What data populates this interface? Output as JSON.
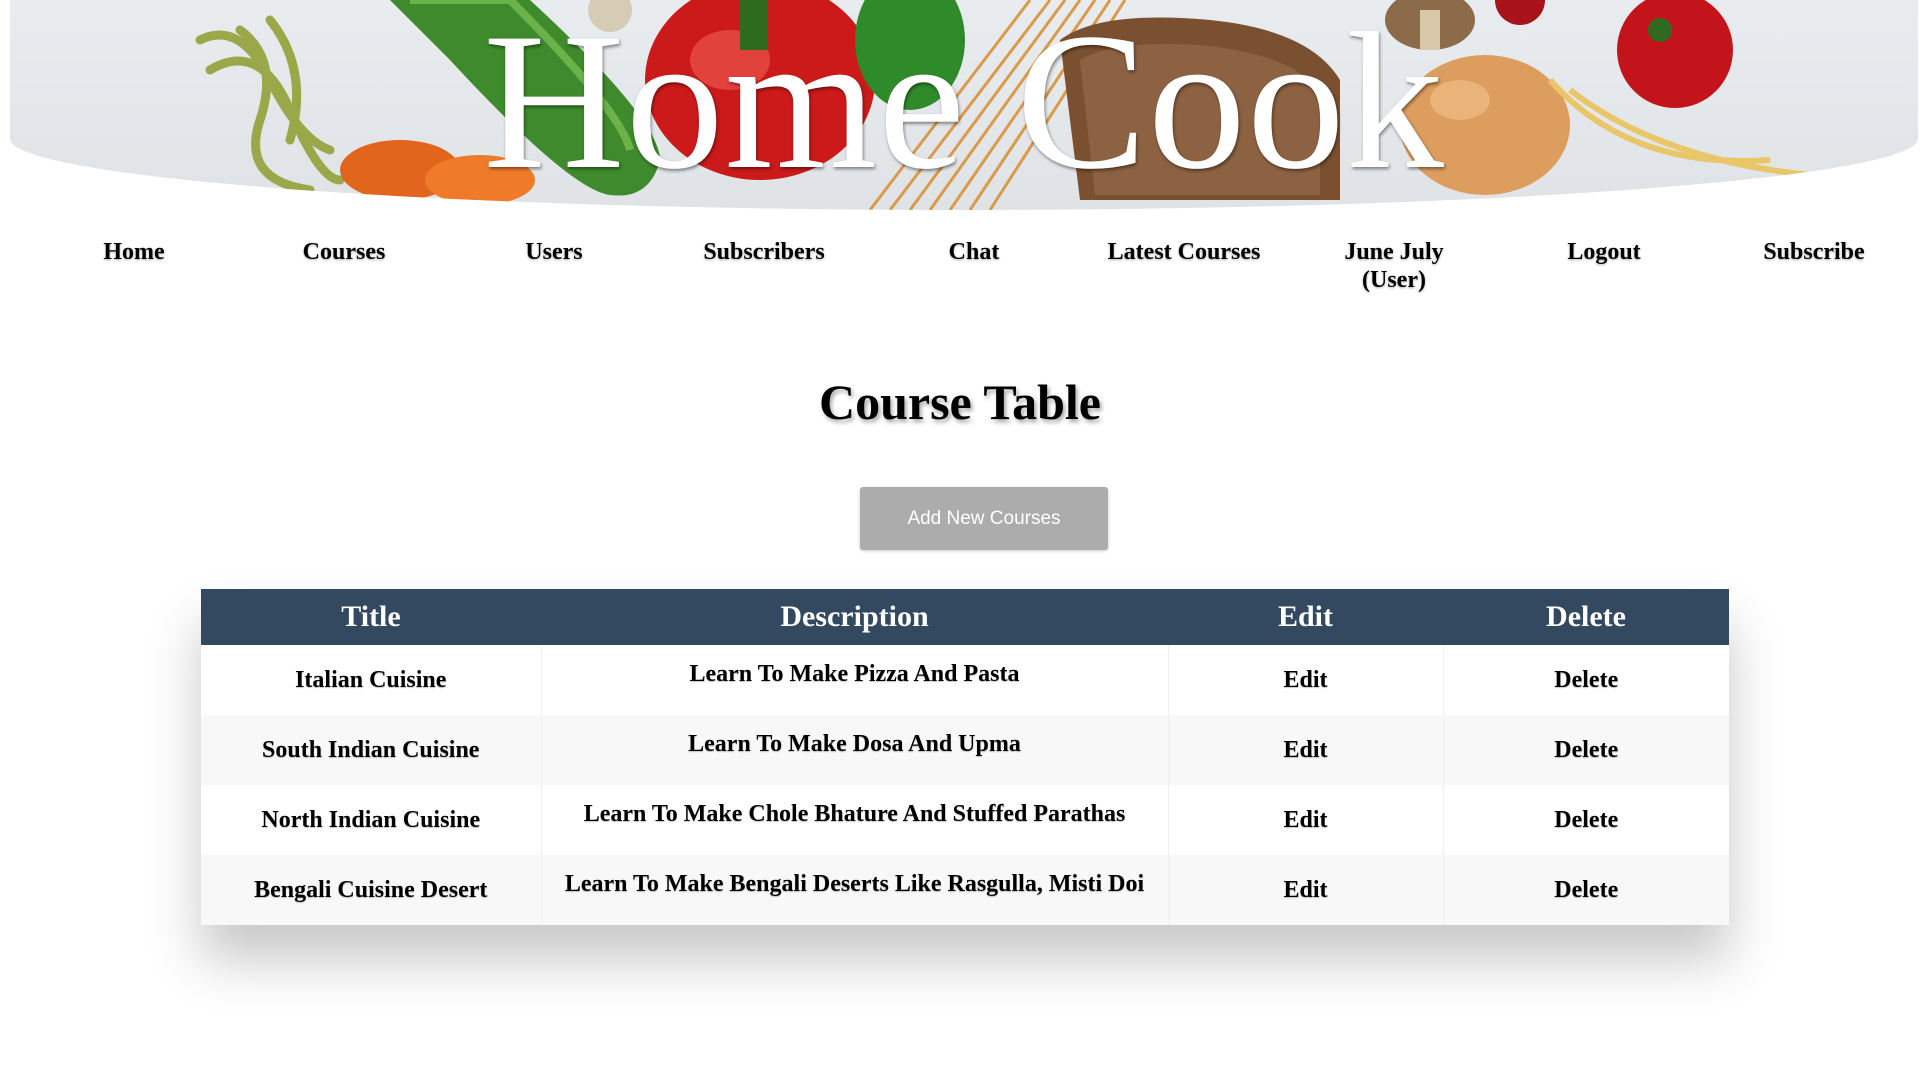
{
  "brand": {
    "title": "Home Cook"
  },
  "nav": {
    "items": [
      {
        "label": "Home"
      },
      {
        "label": "Courses"
      },
      {
        "label": "Users"
      },
      {
        "label": "Subscribers"
      },
      {
        "label": "Chat"
      },
      {
        "label": "Latest Courses"
      },
      {
        "label": "June July (User)"
      },
      {
        "label": "Logout"
      },
      {
        "label": "Subscribe"
      }
    ]
  },
  "main": {
    "heading": "Course Table",
    "add_button_label": "Add New Courses"
  },
  "table": {
    "headers": {
      "title": "Title",
      "description": "Description",
      "edit": "Edit",
      "delete": "Delete"
    },
    "rows": [
      {
        "title": "Italian Cuisine",
        "description": "Learn To Make Pizza And Pasta",
        "edit": "Edit",
        "delete": "Delete"
      },
      {
        "title": "South Indian Cuisine",
        "description": "Learn To Make Dosa And Upma",
        "edit": "Edit",
        "delete": "Delete"
      },
      {
        "title": "North Indian Cuisine",
        "description": "Learn To Make Chole Bhature And Stuffed Parathas",
        "edit": "Edit",
        "delete": "Delete"
      },
      {
        "title": "Bengali Cuisine Desert",
        "description": "Learn To Make Bengali Deserts Like Rasgulla, Misti Doi",
        "edit": "Edit",
        "delete": "Delete"
      }
    ]
  },
  "colors": {
    "table_header_bg": "#324960",
    "button_bg": "#acacac",
    "row_alt_bg": "#f8f8f8"
  }
}
